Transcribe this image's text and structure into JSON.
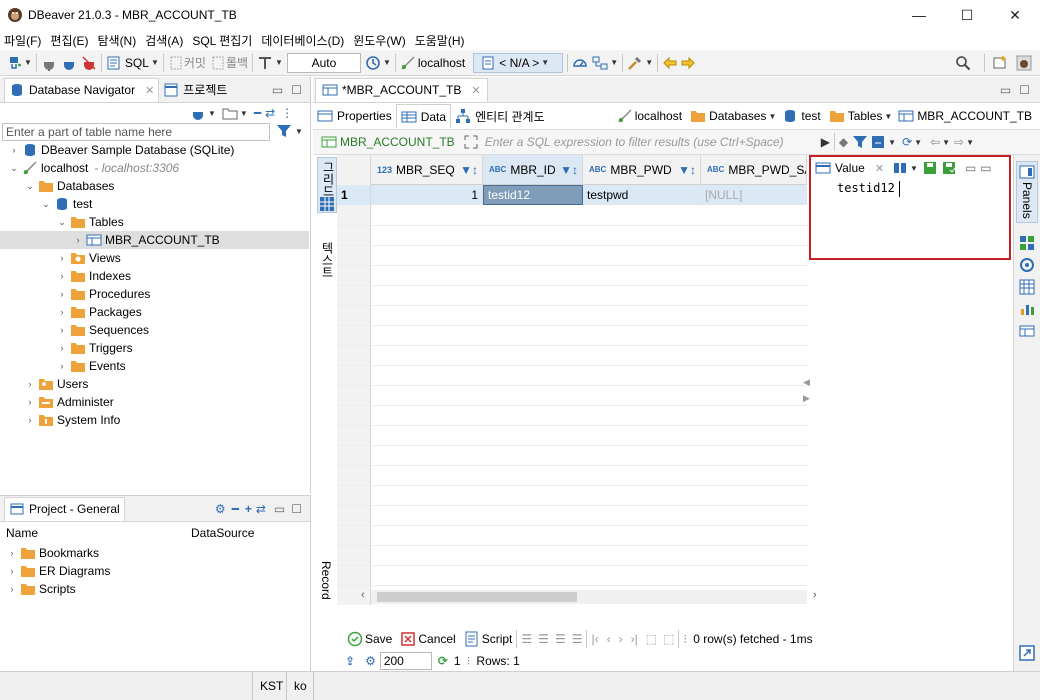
{
  "window": {
    "title": "DBeaver 21.0.3 - MBR_ACCOUNT_TB",
    "minimize_glyph": "—",
    "maximize_glyph": "☐",
    "close_glyph": "✕"
  },
  "menu": [
    "파일(F)",
    "편집(E)",
    "탐색(N)",
    "검색(A)",
    "SQL 편집기",
    "데이터베이스(D)",
    "윈도우(W)",
    "도움말(H)"
  ],
  "toolbar": {
    "sql_label": "SQL",
    "commit_label": "커밋",
    "rollback_label": "롤백",
    "transaction_mode": "Auto",
    "connection": "localhost",
    "schema": "< N/A >"
  },
  "navigator": {
    "tab_label": "Database Navigator",
    "project_tab_label": "프로젝트",
    "filter_placeholder": "Enter a part of table name here",
    "tree": [
      {
        "label": "DBeaver Sample Database (SQLite)",
        "twisty": "›",
        "icon": "db"
      },
      {
        "label": "localhost",
        "sub": "- localhost:3306",
        "twisty": "⌄",
        "icon": "conn"
      },
      {
        "label": "Databases",
        "twisty": "⌄",
        "icon": "folder"
      },
      {
        "label": "test",
        "twisty": "⌄",
        "icon": "db"
      },
      {
        "label": "Tables",
        "twisty": "⌄",
        "icon": "folder"
      },
      {
        "label": "MBR_ACCOUNT_TB",
        "twisty": "›",
        "icon": "table"
      },
      {
        "label": "Views",
        "twisty": "›",
        "icon": "views"
      },
      {
        "label": "Indexes",
        "twisty": "›",
        "icon": "folder"
      },
      {
        "label": "Procedures",
        "twisty": "›",
        "icon": "folder"
      },
      {
        "label": "Packages",
        "twisty": "›",
        "icon": "folder"
      },
      {
        "label": "Sequences",
        "twisty": "›",
        "icon": "folder"
      },
      {
        "label": "Triggers",
        "twisty": "›",
        "icon": "folder"
      },
      {
        "label": "Events",
        "twisty": "›",
        "icon": "folder"
      },
      {
        "label": "Users",
        "twisty": "›",
        "icon": "users"
      },
      {
        "label": "Administer",
        "twisty": "›",
        "icon": "admin"
      },
      {
        "label": "System Info",
        "twisty": "›",
        "icon": "info"
      }
    ]
  },
  "project": {
    "tab_label": "Project - General",
    "columns": [
      "Name",
      "DataSource"
    ],
    "items": [
      "Bookmarks",
      "ER Diagrams",
      "Scripts"
    ]
  },
  "editor": {
    "tab_label": "*MBR_ACCOUNT_TB",
    "subtabs": [
      "Properties",
      "Data",
      "엔티티 관계도"
    ],
    "breadcrumb": [
      "localhost",
      "Databases",
      "test",
      "Tables",
      "MBR_ACCOUNT_TB"
    ],
    "filter_table": "MBR_ACCOUNT_TB",
    "filter_placeholder": "Enter a SQL expression to filter results (use Ctrl+Space)",
    "vtab_grid": "그리드",
    "vtab_text": "텍스트",
    "vtab_record": "Record",
    "columns": [
      {
        "name": "MBR_SEQ",
        "type": "123"
      },
      {
        "name": "MBR_ID",
        "type": "ABC"
      },
      {
        "name": "MBR_PWD",
        "type": "ABC"
      },
      {
        "name": "MBR_PWD_SA",
        "type": "ABC"
      }
    ],
    "rows": [
      {
        "num": "1",
        "cells": [
          "1",
          "testid12",
          "testpwd",
          "[NULL]"
        ]
      }
    ]
  },
  "value_panel": {
    "title": "Value",
    "value": "testid12"
  },
  "right_panel": {
    "label": "Panels"
  },
  "results_bar": {
    "save": "Save",
    "cancel": "Cancel",
    "script": "Script",
    "fetched": "0 row(s) fetched - 1ms",
    "fetch_size": "200",
    "refresh_count": "1",
    "rows": "Rows: 1"
  },
  "status": {
    "timezone": "KST",
    "locale": "ko"
  },
  "colors": {
    "accent_blue": "#2f6db5",
    "folder_orange": "#f0a23a",
    "highlight_red": "#c41e24",
    "selected_cell": "#7f9db9",
    "green": "#3aa13a"
  }
}
